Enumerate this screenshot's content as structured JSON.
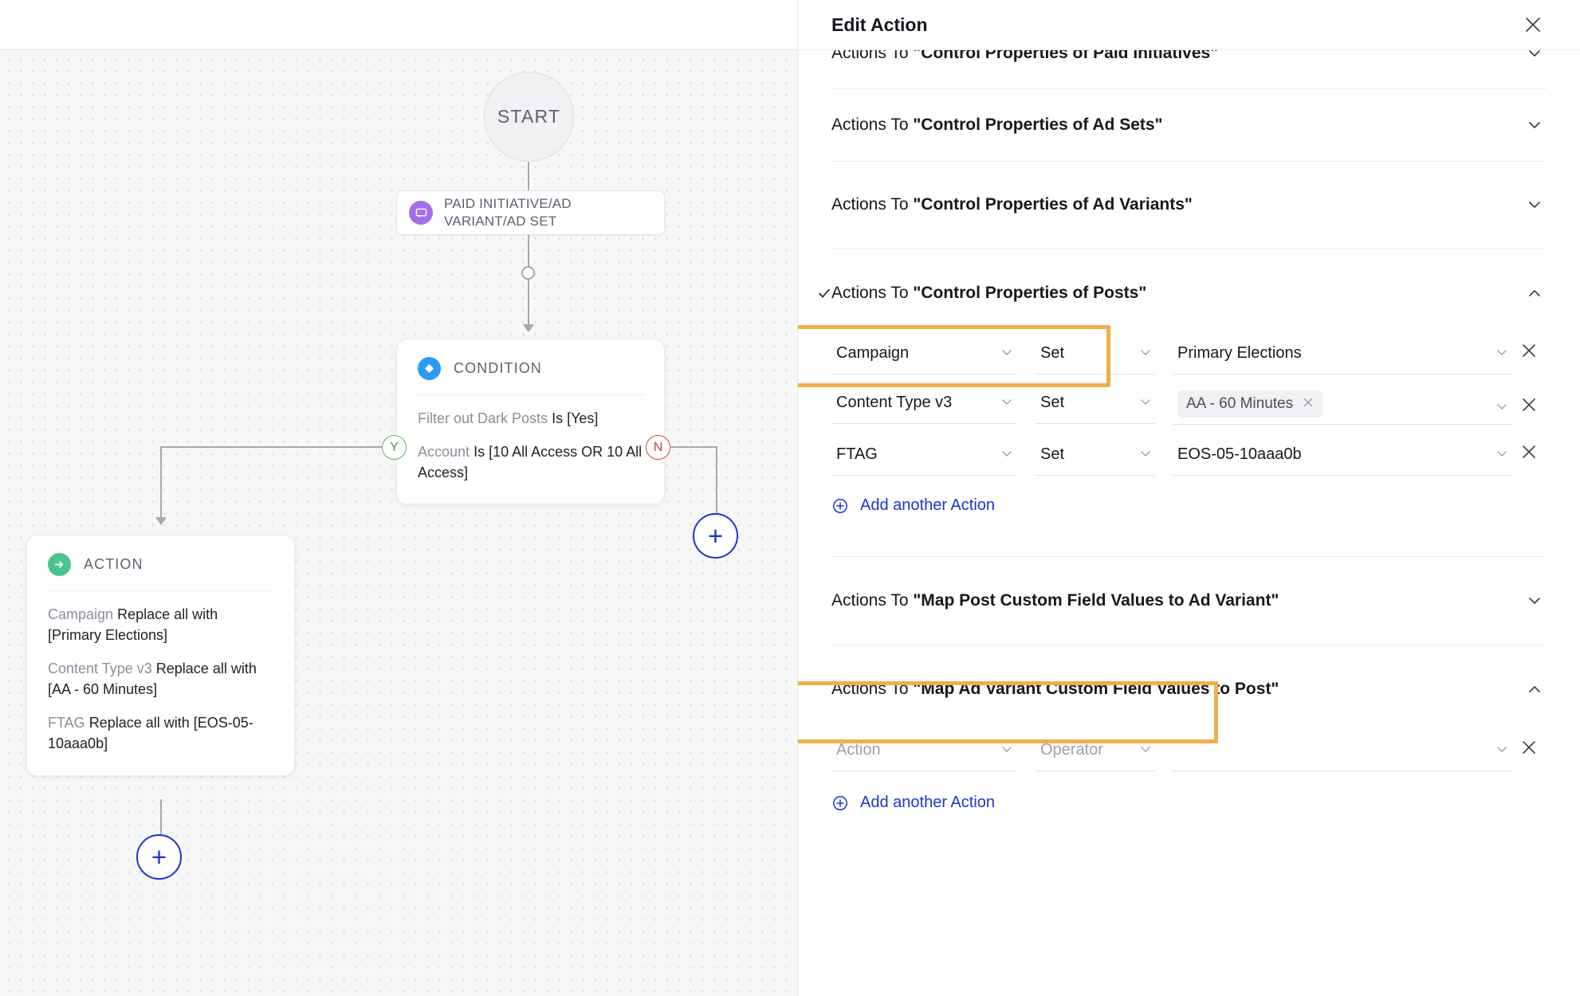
{
  "canvas": {
    "start_label": "START",
    "trigger": {
      "icon": "chat-bubble-icon",
      "label": "PAID INITIATIVE/AD VARIANT/AD SET"
    },
    "condition_node": {
      "type_label": "CONDITION",
      "icon": "diamond-icon",
      "branch_yes": "Y",
      "branch_no": "N",
      "lines": [
        {
          "field": "Filter out Dark Posts",
          "value": "Is [Yes]"
        },
        {
          "field": "Account",
          "value": "Is [10 All Access OR 10 All Access]"
        }
      ]
    },
    "action_node": {
      "type_label": "ACTION",
      "icon": "arrow-right-circle-icon",
      "lines": [
        {
          "field": "Campaign",
          "value": "Replace all with [Primary Elections]"
        },
        {
          "field": "Content Type v3",
          "value": "Replace all with [AA - 60 Minutes]"
        },
        {
          "field": "FTAG",
          "value": "Replace all with [EOS-05-10aaa0b]"
        }
      ]
    },
    "add_step_label": "+"
  },
  "panel": {
    "title": "Edit Action",
    "close_label": "✕",
    "sections": [
      {
        "lead": "Actions To ",
        "name": "\"Control Properties of Paid Initiatives\"",
        "expanded": false,
        "checked": false,
        "highlighted": false,
        "clipped": true
      },
      {
        "lead": "Actions To ",
        "name": "\"Control Properties of Ad Sets\"",
        "expanded": false,
        "checked": false,
        "highlighted": false
      },
      {
        "lead": "Actions To ",
        "name": "\"Control Properties of Ad Variants\"",
        "expanded": false,
        "checked": false,
        "highlighted": false
      },
      {
        "lead": "Actions To ",
        "name": "\"Control Properties of Posts\"",
        "expanded": true,
        "checked": true,
        "highlighted": true
      },
      {
        "lead": "Actions To ",
        "name": "\"Map Post Custom Field Values to Ad Variant\"",
        "expanded": false,
        "checked": false,
        "highlighted": false
      },
      {
        "lead": "Actions To ",
        "name": "\"Map Ad Variant Custom Field Values to Post\"",
        "expanded": true,
        "checked": false,
        "highlighted": true
      }
    ],
    "posts_rows": [
      {
        "field": "Campaign",
        "operator": "Set",
        "value": "Primary Elections",
        "value_is_chip": false
      },
      {
        "field": "Content Type v3",
        "operator": "Set",
        "value": "AA - 60 Minutes",
        "value_is_chip": true
      },
      {
        "field": "FTAG",
        "operator": "Set",
        "value": "EOS-05-10aaa0b",
        "value_is_chip": false
      }
    ],
    "map_rows": [
      {
        "field": "Action",
        "operator": "Operator",
        "value": "",
        "is_placeholder": true
      }
    ],
    "add_another_label": "Add another Action",
    "remove_label": "✕"
  },
  "colors": {
    "highlight_orange": "#eeaf4d",
    "link_blue": "#1b35d0",
    "condition_blue": "#2b9bf4",
    "action_green": "#4cc28f",
    "trigger_purple": "#a46ee8",
    "branch_yes_green": "#55b95c",
    "branch_no_red": "#d9443c"
  }
}
